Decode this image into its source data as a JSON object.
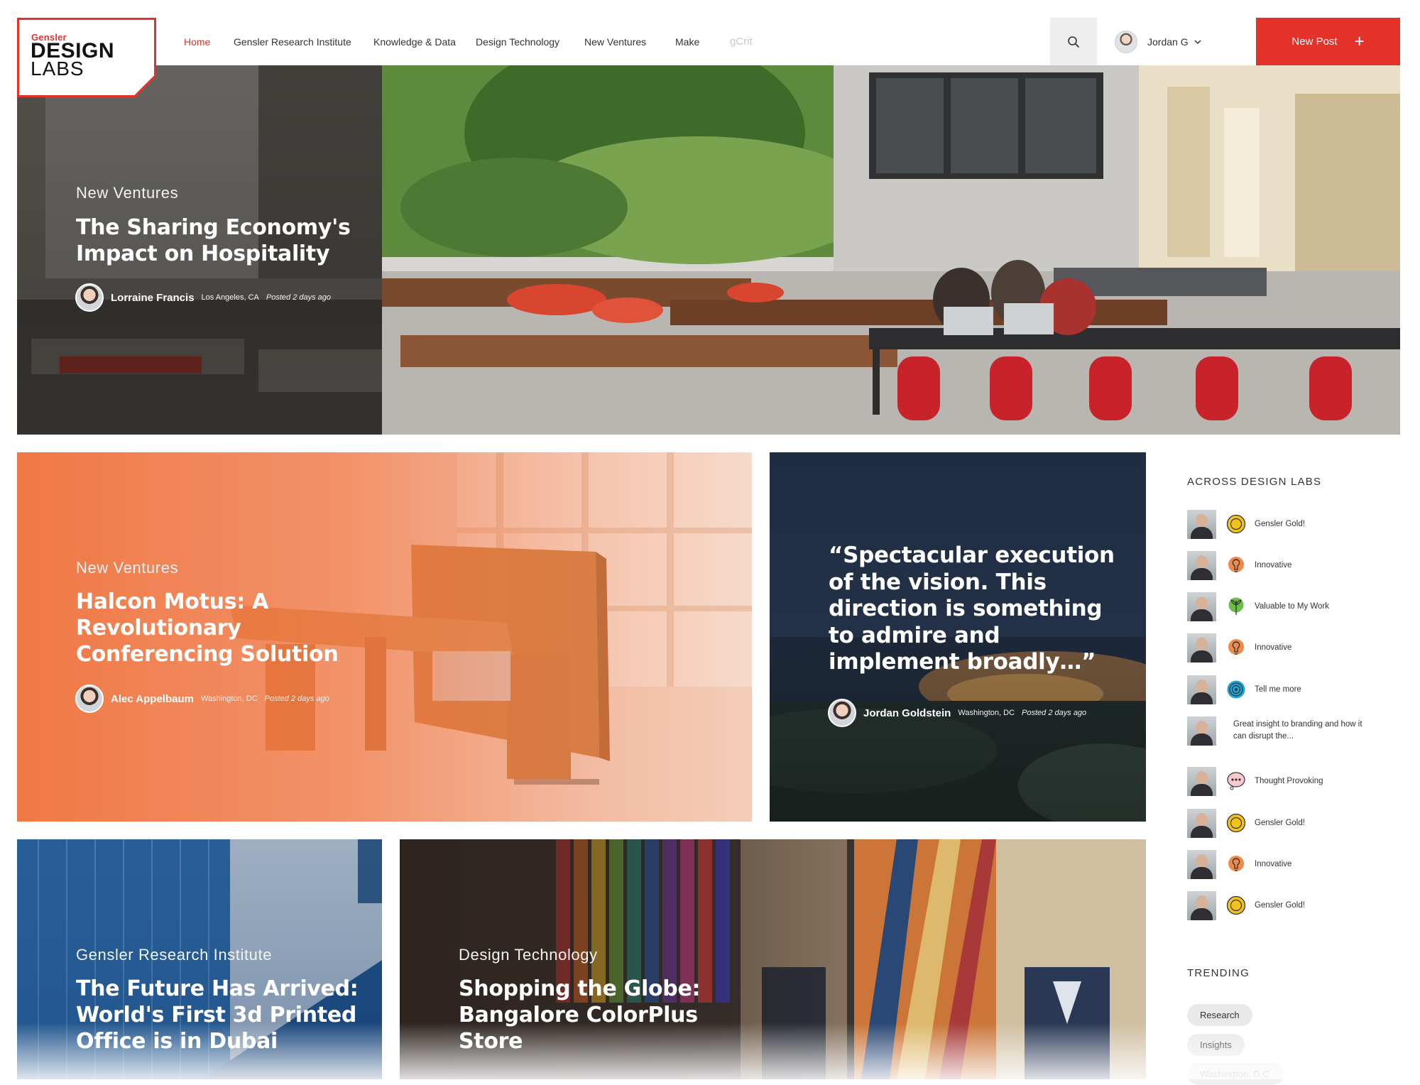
{
  "brand": {
    "small": "Gensler",
    "line1": "DESIGN",
    "line2": "LABS"
  },
  "nav": {
    "items": [
      {
        "label": "Home"
      },
      {
        "label": "Gensler Research Institute"
      },
      {
        "label": "Knowledge & Data"
      },
      {
        "label": "Design Technology"
      },
      {
        "label": "New Ventures"
      },
      {
        "label": "Make"
      },
      {
        "label": "gCrit"
      }
    ],
    "active_index": 0
  },
  "user": {
    "name": "Jordan G"
  },
  "new_post": {
    "label": "New Post",
    "icon": "+"
  },
  "hero": {
    "category": "New Ventures",
    "title_line1": "The Sharing Economy's",
    "title_line2": "Impact on Hospitality",
    "author": "Lorraine Francis",
    "location": "Los Angeles, CA",
    "posted": "Posted 2 days ago"
  },
  "feature": {
    "category": "New Ventures",
    "title_line1": "Halcon Motus: A",
    "title_line2": "Revolutionary",
    "title_line3": "Conferencing Solution",
    "author": "Alec Appelbaum",
    "location": "Washington, DC",
    "posted": "Posted 2 days ago"
  },
  "quote": {
    "line1": "“Spectacular execution",
    "line2": "of the vision.  This",
    "line3": "direction is something",
    "line4": "to admire and",
    "line5": "implement broadly…”",
    "author": "Jordan Goldstein",
    "location": "Washington, DC",
    "posted": "Posted 2 days ago"
  },
  "research": {
    "category": "Gensler Research Institute",
    "title_line1": "The Future Has Arrived:",
    "title_line2": "World's First 3d Printed",
    "title_line3": "Office is in Dubai"
  },
  "shopping": {
    "category": "Design Technology",
    "title_line1": "Shopping the Globe:",
    "title_line2": "Bangalore ColorPlus",
    "title_line3": "Store"
  },
  "across": {
    "heading": "ACROSS DESIGN LABS",
    "items": [
      {
        "badge": "gold-coin-icon",
        "badge_color": "#f2c21b",
        "label": "Gensler Gold!"
      },
      {
        "badge": "lightbulb-icon",
        "badge_color": "#f08a4b",
        "label": "Innovative"
      },
      {
        "badge": "sprout-icon",
        "badge_color": "#6cc04a",
        "label": "Valuable to My Work"
      },
      {
        "badge": "lightbulb-icon",
        "badge_color": "#f08a4b",
        "label": "Innovative"
      },
      {
        "badge": "spiral-icon",
        "badge_color": "#1ea3d9",
        "label": "Tell me more"
      },
      {
        "badge": "none",
        "badge_color": "",
        "label": "Great insight to branding and how it can disrupt the..."
      },
      {
        "badge": "thought-bubble-icon",
        "badge_color": "#f28b9b",
        "label": "Thought Provoking"
      },
      {
        "badge": "gold-coin-icon",
        "badge_color": "#f2c21b",
        "label": "Gensler Gold!"
      },
      {
        "badge": "lightbulb-icon",
        "badge_color": "#f08a4b",
        "label": "Innovative"
      },
      {
        "badge": "gold-coin-icon",
        "badge_color": "#f2c21b",
        "label": "Gensler Gold!"
      }
    ]
  },
  "trending": {
    "heading": "TRENDING",
    "tags": [
      "Research",
      "Insights",
      "Washington, D.C."
    ]
  },
  "colors": {
    "accent": "#e4322b",
    "orange_overlay": "#f0703a",
    "navy_overlay": "#1c2a3f"
  }
}
